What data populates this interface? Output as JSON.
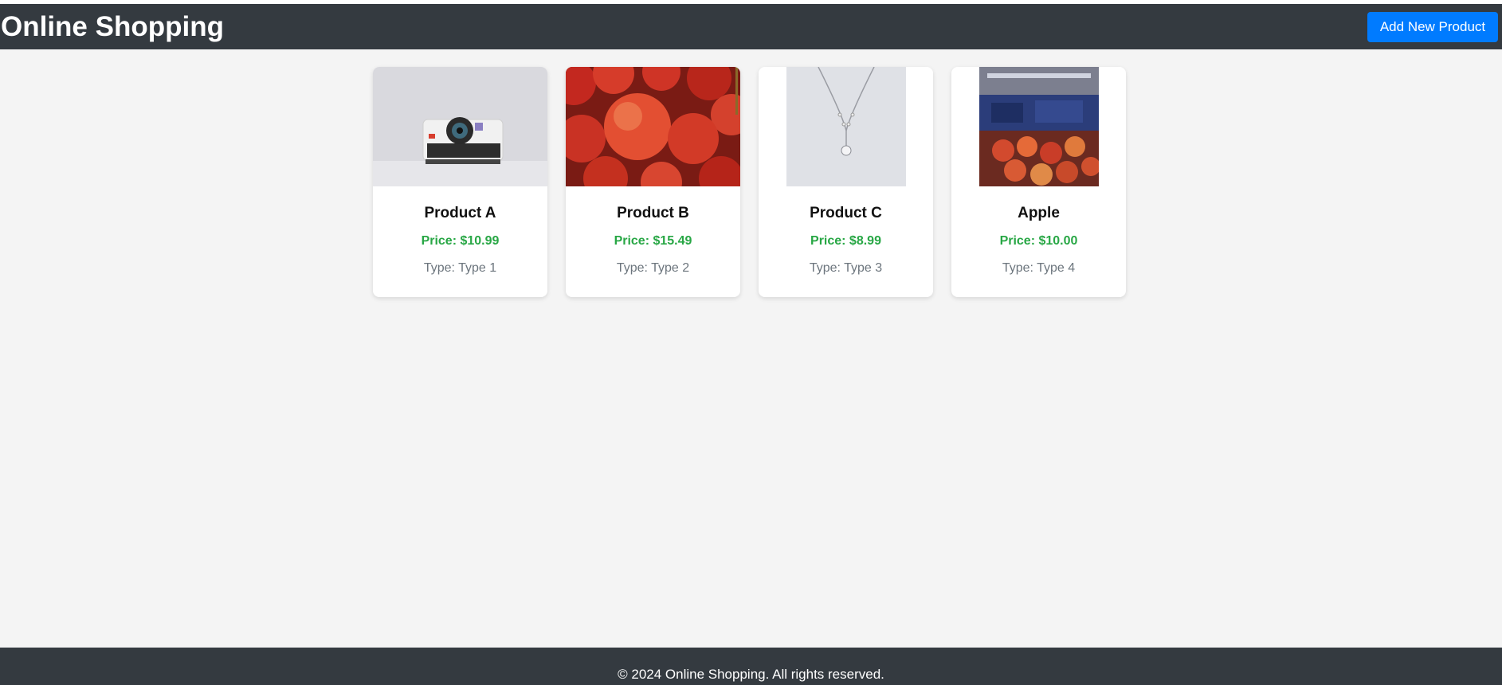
{
  "header": {
    "title": "Online Shopping",
    "add_button_label": "Add New Product"
  },
  "products": [
    {
      "name": "Product A",
      "price": "Price: $10.99",
      "type": "Type: Type 1",
      "image": "instant-camera"
    },
    {
      "name": "Product B",
      "price": "Price: $15.49",
      "type": "Type: Type 2",
      "image": "red-apples"
    },
    {
      "name": "Product C",
      "price": "Price: $8.99",
      "type": "Type: Type 3",
      "image": "diamond-necklace"
    },
    {
      "name": "Apple",
      "price": "Price: $10.00",
      "type": "Type: Type 4",
      "image": "apples-in-store"
    }
  ],
  "footer": {
    "text": "© 2024 Online Shopping. All rights reserved."
  },
  "colors": {
    "header_bg": "#343a40",
    "button_bg": "#007bff",
    "price": "#28a745",
    "type": "#6c757d",
    "page_bg": "#f4f4f4"
  }
}
